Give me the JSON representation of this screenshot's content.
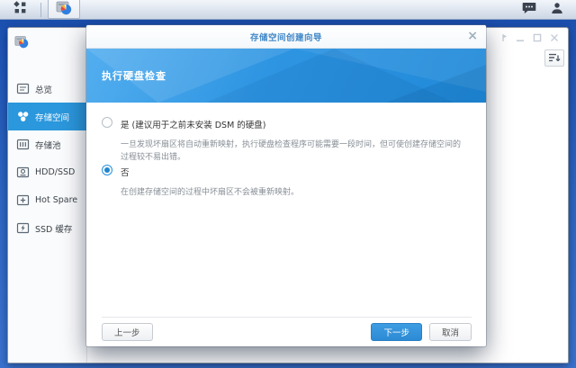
{
  "taskbar": {
    "main_menu_icon": "app-grid",
    "active_app_icon": "storage-manager",
    "chat_icon": "chat-bubble",
    "user_icon": "person-silhouette"
  },
  "window": {
    "controls": [
      "pin",
      "minimize",
      "maximize",
      "close"
    ],
    "toolbar_sort_icon": "sort-descending",
    "sidebar": {
      "app_icon": "storage-manager",
      "items": [
        {
          "label": "总览",
          "icon": "overview-icon",
          "selected": false
        },
        {
          "label": "存储空间",
          "icon": "storage-volume-icon",
          "selected": true
        },
        {
          "label": "存储池",
          "icon": "storage-pool-icon",
          "selected": false
        },
        {
          "label": "HDD/SSD",
          "icon": "hdd-ssd-icon",
          "selected": false
        },
        {
          "label": "Hot Spare",
          "icon": "hot-spare-icon",
          "selected": false
        },
        {
          "label": "SSD 缓存",
          "icon": "ssd-cache-icon",
          "selected": false
        }
      ]
    }
  },
  "dialog": {
    "title": "存储空间创建向导",
    "close_glyph": "×",
    "heading": "执行硬盘检查",
    "options": [
      {
        "label": "是 (建议用于之前未安装 DSM 的硬盘)",
        "description": "一旦发现坏扇区将自动重新映射，执行硬盘检查程序可能需要一段时间，但可使创建存储空间的过程较不易出错。",
        "selected": false
      },
      {
        "label": "否",
        "description": "在创建存储空间的过程中坏扇区不会被重新映射。",
        "selected": true
      }
    ],
    "buttons": {
      "previous": "上一步",
      "next": "下一步",
      "cancel": "取消"
    }
  },
  "colors": {
    "desktop_blue": "#2e68c4",
    "sidebar_selected": "#2b97dc",
    "banner_blue": "#2e95e2",
    "primary_button": "#2d8ad5",
    "dialog_title_text": "#4288c8"
  }
}
